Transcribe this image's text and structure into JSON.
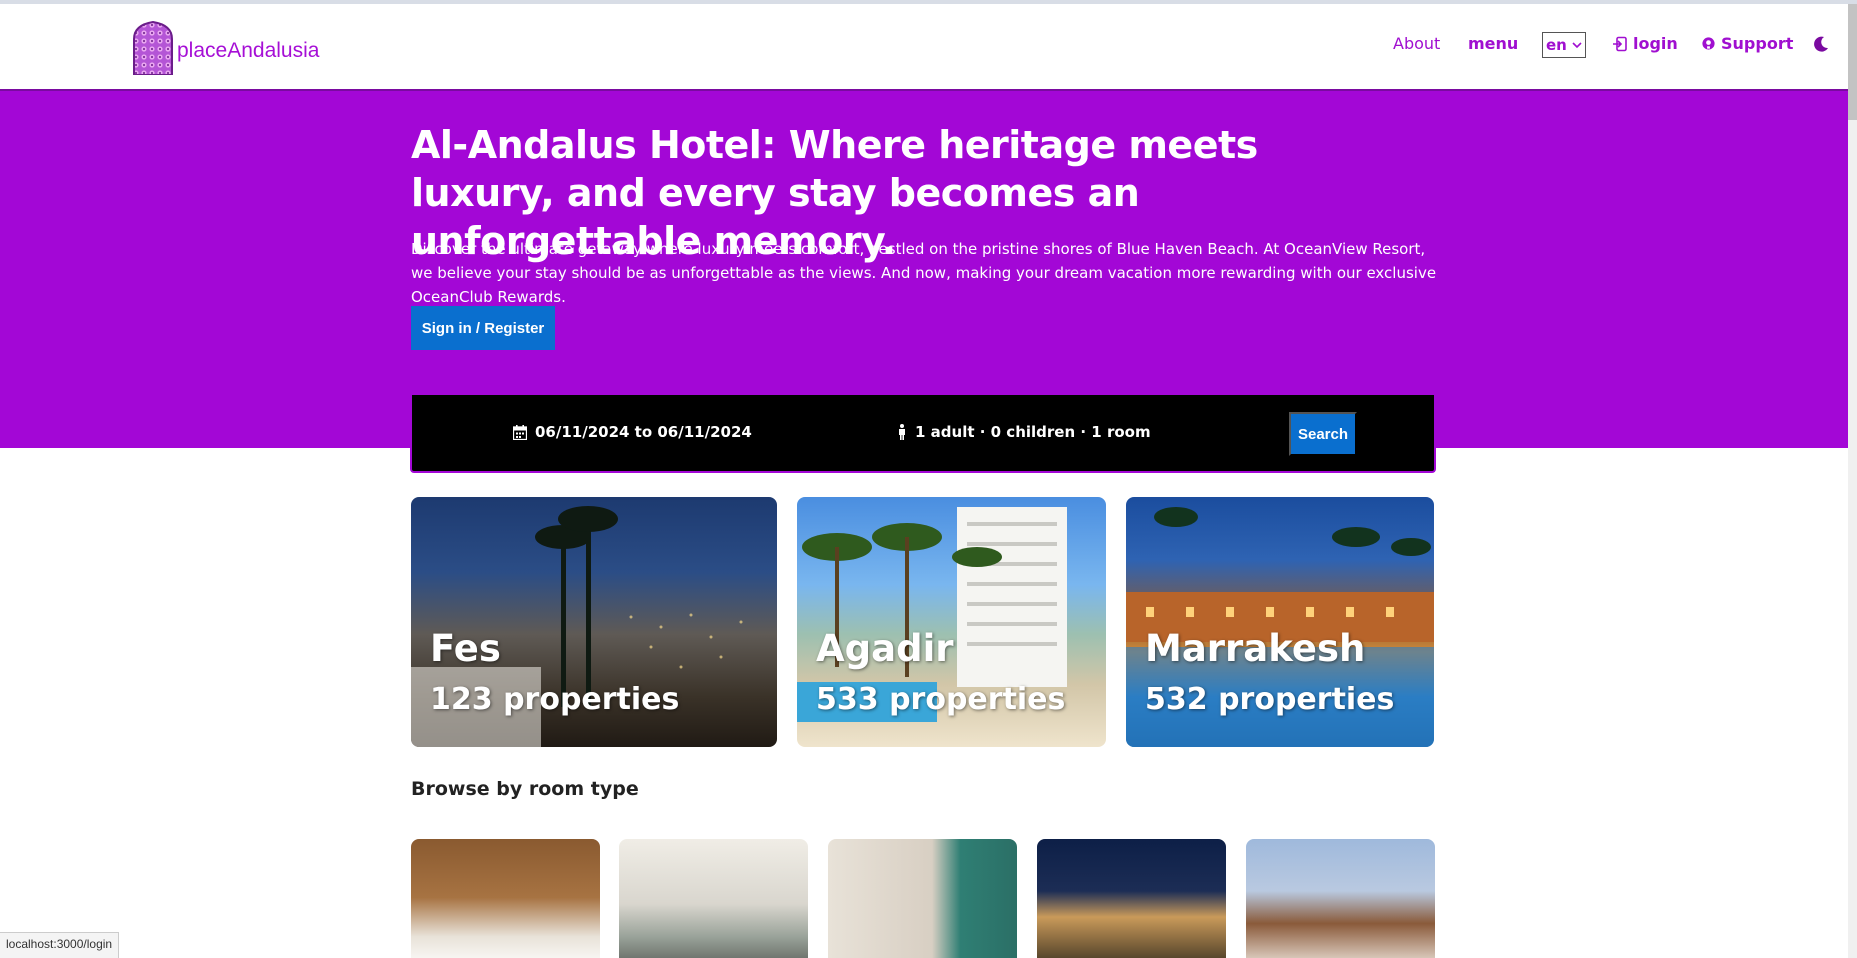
{
  "brand": {
    "name": "placeAndalusia"
  },
  "nav": {
    "about": "About",
    "menu": "menu",
    "language": "en",
    "login": "login",
    "support": "Support"
  },
  "hero": {
    "title": "Al-Andalus Hotel: Where heritage meets luxury, and every stay becomes an unforgettable memory.",
    "description": "Discover the ultimate getaway where luxury meets comfort, nestled on the pristine shores of Blue Haven Beach. At OceanView Resort, we believe your stay should be as unforgettable as the views. And now, making your dream vacation more rewarding with our exclusive OceanClub Rewards.",
    "cta": "Sign in / Register"
  },
  "search": {
    "dates": "06/11/2024 to 06/11/2024",
    "guests": "1 adult · 0 children · 1 room",
    "button": "Search"
  },
  "cities": [
    {
      "name": "Fes",
      "count": "123 properties"
    },
    {
      "name": "Agadir",
      "count": "533 properties"
    },
    {
      "name": "Marrakesh",
      "count": "532 properties"
    }
  ],
  "browse": {
    "title": "Browse by room type"
  },
  "statusbar": {
    "url": "localhost:3000/login"
  },
  "colors": {
    "brand": "#a307d6",
    "button": "#0a6fcf",
    "searchbar": "#000000"
  },
  "icons": [
    "logo-icon",
    "chevron-down-icon",
    "login-icon",
    "support-icon",
    "moon-icon",
    "calendar-icon",
    "person-icon"
  ]
}
